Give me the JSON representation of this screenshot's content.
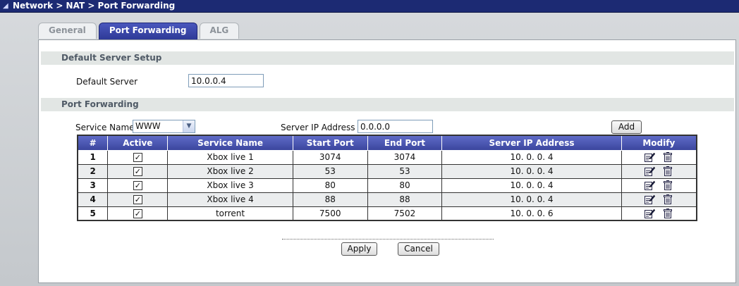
{
  "breadcrumb": "Network > NAT > Port Forwarding",
  "tabs": [
    {
      "label": "General",
      "active": false
    },
    {
      "label": "Port Forwarding",
      "active": true
    },
    {
      "label": "ALG",
      "active": false
    }
  ],
  "default_server_setup": {
    "title": "Default Server Setup",
    "label": "Default Server",
    "value": "10.0.0.4"
  },
  "port_forwarding": {
    "title": "Port Forwarding",
    "service_name_label": "Service Name",
    "service_name_selected": "WWW",
    "server_ip_label": "Server IP Address",
    "server_ip_value": "0.0.0.0",
    "add_label": "Add"
  },
  "table": {
    "headers": [
      "#",
      "Active",
      "Service Name",
      "Start Port",
      "End Port",
      "Server IP Address",
      "Modify"
    ],
    "rows": [
      {
        "num": "1",
        "active": true,
        "service": "Xbox live 1",
        "start": "3074",
        "end": "3074",
        "ip": "10. 0. 0. 4"
      },
      {
        "num": "2",
        "active": true,
        "service": "Xbox live 2",
        "start": "53",
        "end": "53",
        "ip": "10. 0. 0. 4"
      },
      {
        "num": "3",
        "active": true,
        "service": "Xbox live 3",
        "start": "80",
        "end": "80",
        "ip": "10. 0. 0. 4"
      },
      {
        "num": "4",
        "active": true,
        "service": "Xbox live 4",
        "start": "88",
        "end": "88",
        "ip": "10. 0. 0. 4"
      },
      {
        "num": "5",
        "active": true,
        "service": "torrent",
        "start": "7500",
        "end": "7502",
        "ip": "10. 0. 0. 6"
      }
    ]
  },
  "actions": {
    "apply_label": "Apply",
    "cancel_label": "Cancel"
  },
  "icons": {
    "edit": "edit-icon",
    "delete": "trash-icon",
    "checkbox": "check-icon",
    "dropdown": "chevron-down-icon"
  },
  "colors": {
    "titlebar": "#1c2a73",
    "tab_active": "#3a46a8",
    "table_header": "#4a55b0",
    "section_bar": "#e2e6e4"
  }
}
